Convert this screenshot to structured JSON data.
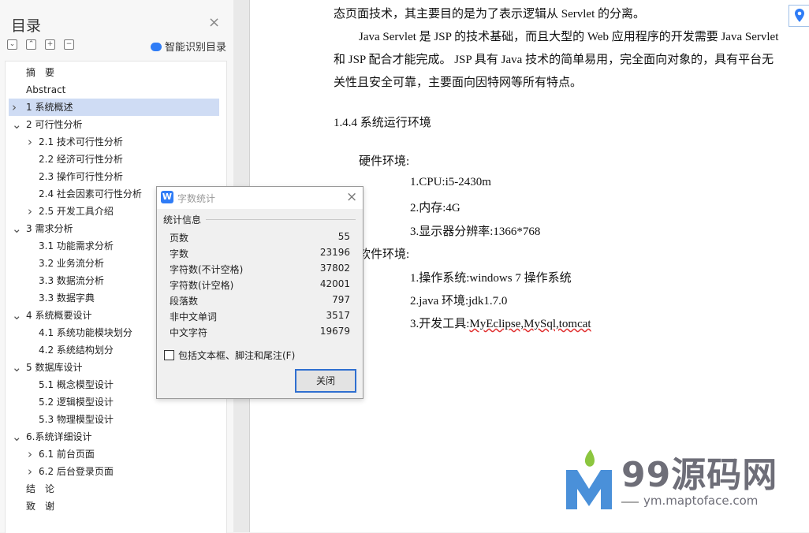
{
  "toc": {
    "title": "目录",
    "smart_label": "智能识别目录",
    "items": [
      {
        "label": "摘　要",
        "level": 0,
        "chev": ""
      },
      {
        "label": "Abstract",
        "level": 0,
        "chev": ""
      },
      {
        "label": "1 系统概述",
        "level": 0,
        "chev": ">",
        "selected": true
      },
      {
        "label": "2 可行性分析",
        "level": 0,
        "chev": "v"
      },
      {
        "label": "2.1  技术可行性分析",
        "level": 1,
        "chev": ">"
      },
      {
        "label": "2.2  经济可行性分析",
        "level": 1,
        "chev": ""
      },
      {
        "label": "2.3  操作可行性分析",
        "level": 1,
        "chev": ""
      },
      {
        "label": "2.4  社会因素可行性分析",
        "level": 1,
        "chev": ""
      },
      {
        "label": "2.5 开发工具介绍",
        "level": 1,
        "chev": ">"
      },
      {
        "label": "3  需求分析",
        "level": 0,
        "chev": "v"
      },
      {
        "label": "3.1  功能需求分析",
        "level": 1,
        "chev": ""
      },
      {
        "label": "3.2  业务流分析",
        "level": 1,
        "chev": ""
      },
      {
        "label": "3.3  数据流分析",
        "level": 1,
        "chev": ""
      },
      {
        "label": "3.3  数据字典",
        "level": 1,
        "chev": ""
      },
      {
        "label": "4  系统概要设计",
        "level": 0,
        "chev": "v"
      },
      {
        "label": "4.1  系统功能模块划分",
        "level": 1,
        "chev": ""
      },
      {
        "label": "4.2  系统结构划分",
        "level": 1,
        "chev": ""
      },
      {
        "label": "5  数据库设计",
        "level": 0,
        "chev": "v"
      },
      {
        "label": "5.1  概念模型设计",
        "level": 1,
        "chev": ""
      },
      {
        "label": "5.2  逻辑模型设计",
        "level": 1,
        "chev": ""
      },
      {
        "label": "5.3  物理模型设计",
        "level": 1,
        "chev": ""
      },
      {
        "label": "6.系统详细设计",
        "level": 0,
        "chev": "v"
      },
      {
        "label": "6.1  前台页面",
        "level": 1,
        "chev": ">"
      },
      {
        "label": "6.2  后台登录页面",
        "level": 1,
        "chev": ">"
      },
      {
        "label": "结　论",
        "level": 0,
        "chev": ""
      },
      {
        "label": "致　谢",
        "level": 0,
        "chev": ""
      }
    ]
  },
  "doc": {
    "lines": [
      "态页面技术，其主要目的是为了表示逻辑从 Servlet 的分离。",
      "Java Servlet 是 JSP 的技术基础，而且大型的 Web 应用程序的开发需要 Java Servlet",
      "和 JSP 配合才能完成。 JSP  具有 Java 技术的简单易用，完全面向对象的，具有平台无",
      "关性且安全可靠，主要面向因特网等所有特点。",
      "1.4.4  系统运行环境",
      "硬件环境:",
      "1.CPU:i5-2430m",
      "2.内存:4G",
      "3.显示器分辨率:1366*768",
      "软件环境:",
      "1.操作系统:windows 7  操作系统",
      "2.java 环境:jdk1.7.0",
      "3.开发工具:MyEclipse,MySql,tomcat"
    ]
  },
  "dialog": {
    "title": "字数统计",
    "group_label": "统计信息",
    "stats": [
      {
        "label": "页数",
        "value": "55"
      },
      {
        "label": "字数",
        "value": "23196"
      },
      {
        "label": "字符数(不计空格)",
        "value": "37802"
      },
      {
        "label": "字符数(计空格)",
        "value": "42001"
      },
      {
        "label": "段落数",
        "value": "797"
      },
      {
        "label": "非中文单词",
        "value": "3517"
      },
      {
        "label": "中文字符",
        "value": "19679"
      }
    ],
    "checkbox_label": "包括文本框、脚注和尾注(F)",
    "checkbox_checked": false,
    "close_label": "关闭"
  },
  "watermark": {
    "brand": "99源码网",
    "url": "ym.maptoface.com"
  }
}
